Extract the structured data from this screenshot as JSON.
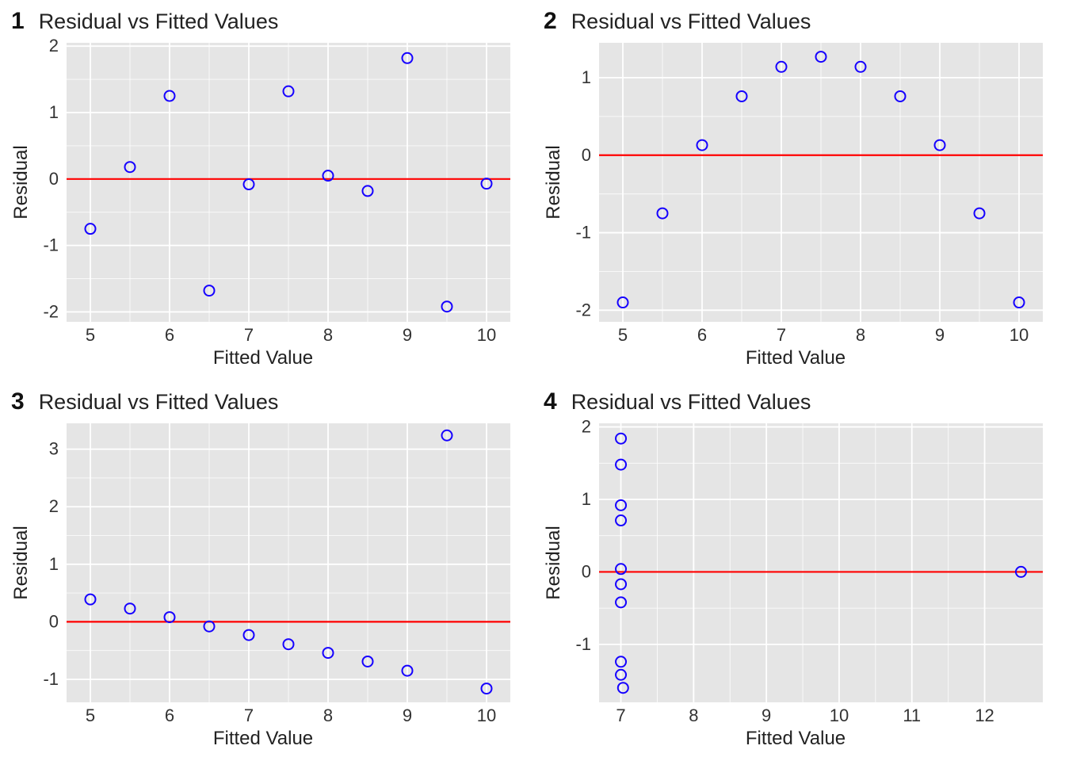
{
  "chart_data": [
    {
      "type": "scatter",
      "panel_number": "1",
      "title": "Residual vs Fitted Values",
      "xlabel": "Fitted Value",
      "ylabel": "Residual",
      "xlim": [
        4.7,
        10.3
      ],
      "ylim": [
        -2.15,
        2.05
      ],
      "xticks": [
        5,
        6,
        7,
        8,
        9,
        10
      ],
      "yticks": [
        -2,
        -1,
        0,
        1,
        2
      ],
      "refline_y": 0,
      "points": [
        {
          "x": 5.0,
          "y": -0.75
        },
        {
          "x": 5.5,
          "y": 0.18
        },
        {
          "x": 6.0,
          "y": 1.25
        },
        {
          "x": 6.5,
          "y": -1.68
        },
        {
          "x": 7.0,
          "y": -0.08
        },
        {
          "x": 7.5,
          "y": 1.32
        },
        {
          "x": 8.0,
          "y": 0.05
        },
        {
          "x": 8.5,
          "y": -0.18
        },
        {
          "x": 9.0,
          "y": 1.82
        },
        {
          "x": 9.5,
          "y": -1.92
        },
        {
          "x": 10.0,
          "y": -0.07
        }
      ]
    },
    {
      "type": "scatter",
      "panel_number": "2",
      "title": "Residual vs Fitted Values",
      "xlabel": "Fitted Value",
      "ylabel": "Residual",
      "xlim": [
        4.7,
        10.3
      ],
      "ylim": [
        -2.15,
        1.45
      ],
      "xticks": [
        5,
        6,
        7,
        8,
        9,
        10
      ],
      "yticks": [
        -2,
        -1,
        0,
        1
      ],
      "refline_y": 0,
      "points": [
        {
          "x": 5.0,
          "y": -1.9
        },
        {
          "x": 5.5,
          "y": -0.75
        },
        {
          "x": 6.0,
          "y": 0.13
        },
        {
          "x": 6.5,
          "y": 0.76
        },
        {
          "x": 7.0,
          "y": 1.14
        },
        {
          "x": 7.5,
          "y": 1.27
        },
        {
          "x": 8.0,
          "y": 1.14
        },
        {
          "x": 8.5,
          "y": 0.76
        },
        {
          "x": 9.0,
          "y": 0.13
        },
        {
          "x": 9.5,
          "y": -0.75
        },
        {
          "x": 10.0,
          "y": -1.9
        }
      ]
    },
    {
      "type": "scatter",
      "panel_number": "3",
      "title": "Residual vs Fitted Values",
      "xlabel": "Fitted Value",
      "ylabel": "Residual",
      "xlim": [
        4.7,
        10.3
      ],
      "ylim": [
        -1.4,
        3.45
      ],
      "xticks": [
        5,
        6,
        7,
        8,
        9,
        10
      ],
      "yticks": [
        -1,
        0,
        1,
        2,
        3
      ],
      "refline_y": 0,
      "points": [
        {
          "x": 5.0,
          "y": 0.39
        },
        {
          "x": 5.5,
          "y": 0.23
        },
        {
          "x": 6.0,
          "y": 0.08
        },
        {
          "x": 6.5,
          "y": -0.08
        },
        {
          "x": 7.0,
          "y": -0.23
        },
        {
          "x": 7.5,
          "y": -0.39
        },
        {
          "x": 8.0,
          "y": -0.54
        },
        {
          "x": 8.5,
          "y": -0.69
        },
        {
          "x": 9.0,
          "y": -0.85
        },
        {
          "x": 9.5,
          "y": 3.24
        },
        {
          "x": 10.0,
          "y": -1.16
        }
      ]
    },
    {
      "type": "scatter",
      "panel_number": "4",
      "title": "Residual vs Fitted Values",
      "xlabel": "Fitted Value",
      "ylabel": "Residual",
      "xlim": [
        6.7,
        12.8
      ],
      "ylim": [
        -1.8,
        2.05
      ],
      "xticks": [
        7,
        8,
        9,
        10,
        11,
        12
      ],
      "yticks": [
        -1,
        0,
        1,
        2
      ],
      "refline_y": 0,
      "points": [
        {
          "x": 7.0,
          "y": 1.84
        },
        {
          "x": 7.0,
          "y": 1.48
        },
        {
          "x": 7.0,
          "y": 0.92
        },
        {
          "x": 7.0,
          "y": 0.71
        },
        {
          "x": 7.0,
          "y": 0.04
        },
        {
          "x": 7.0,
          "y": -0.17
        },
        {
          "x": 7.0,
          "y": -0.42
        },
        {
          "x": 7.0,
          "y": -1.24
        },
        {
          "x": 7.0,
          "y": -1.42
        },
        {
          "x": 7.03,
          "y": -1.6
        },
        {
          "x": 12.5,
          "y": 0.0
        }
      ]
    }
  ]
}
